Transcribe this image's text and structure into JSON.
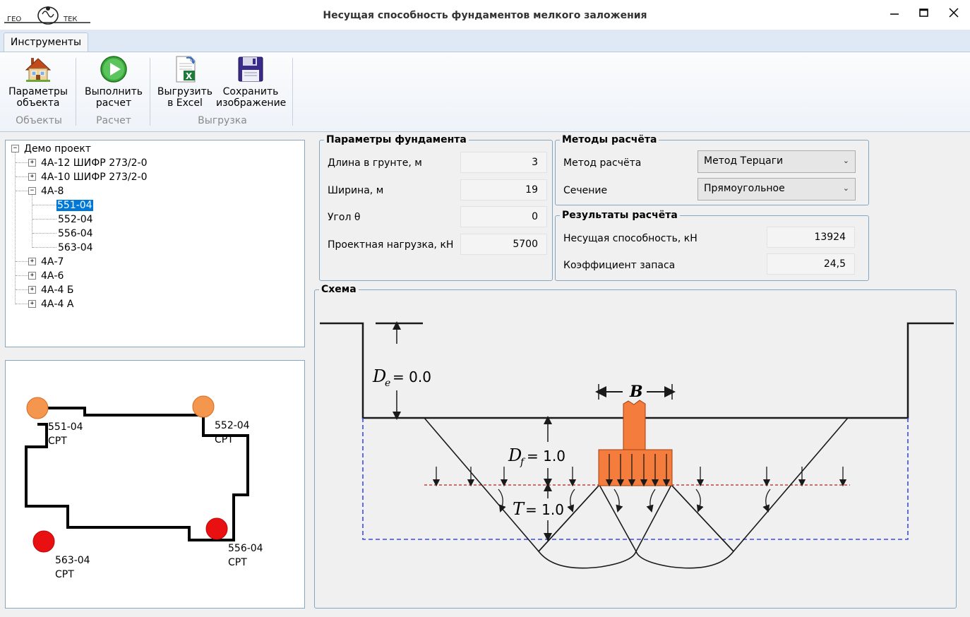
{
  "window": {
    "logo_text": "ГЕО ТЕК",
    "title": "Несущая способность фундаментов мелкого заложения",
    "minimize_glyph": "—",
    "maximize_glyph": "□",
    "close_glyph": "✕"
  },
  "ribbon": {
    "tab_label": "Инструменты",
    "buttons": [
      {
        "line1": "Параметры",
        "line2": "объекта",
        "icon": "house-icon"
      },
      {
        "line1": "Выполнить",
        "line2": "расчет",
        "icon": "play-icon"
      },
      {
        "line1": "Выгрузить",
        "line2": "в Excel",
        "icon": "excel-icon"
      },
      {
        "line1": "Сохранить",
        "line2": "изображение",
        "icon": "floppy-icon"
      }
    ],
    "groups": [
      "Объекты",
      "Расчет",
      "Выгрузка"
    ]
  },
  "tree": {
    "root": "Демо проект",
    "items": [
      "4А-12 ШИФР 273/2-0",
      "4А-10 ШИФР 273/2-0",
      "4А-8",
      "4А-7",
      "4А-6",
      "4А-4 Б",
      "4А-4 А"
    ],
    "children": [
      "551-04",
      "552-04",
      "556-04",
      "563-04"
    ],
    "plus": "+",
    "minus": "−"
  },
  "map": {
    "points": [
      {
        "id": "551-04",
        "type": "CPT",
        "color": "#f4964e"
      },
      {
        "id": "552-04",
        "type": "CPT",
        "color": "#f4964e"
      },
      {
        "id": "556-04",
        "type": "CPT",
        "color": "#e81010"
      },
      {
        "id": "563-04",
        "type": "CPT",
        "color": "#e81010"
      }
    ]
  },
  "foundation_params": {
    "title": "Параметры фундамента",
    "length_label": "Длина в грунте, м",
    "length_value": "3",
    "width_label": "Ширина, м",
    "width_value": "19",
    "angle_label": "Угол θ",
    "angle_value": "0",
    "load_label": "Проектная нагрузка, кН",
    "load_value": "5700"
  },
  "methods": {
    "title": "Методы расчёта",
    "method_label": "Метод расчёта",
    "method_value": "Метод Терцаги",
    "section_label": "Сечение",
    "section_value": "Прямоугольное",
    "chevron": "⌄"
  },
  "results": {
    "title": "Результаты расчёта",
    "capacity_label": "Несущая способность, кН",
    "capacity_value": "13924",
    "safety_label": "Коэффициент запаса",
    "safety_value": "24,5"
  },
  "scheme": {
    "title": "Схема",
    "de_sym": "D",
    "de_sub": "e",
    "de_val": "= 0.0",
    "df_sym": "D",
    "df_sub": "f",
    "df_val": "= 1.0",
    "t_sym": "T",
    "t_val": "= 1.0",
    "b_sym": "B",
    "footing_color": "#f47c3c",
    "line_color": "#1a1a1a",
    "dashed_blue": "#3b48e8",
    "dashed_red": "#b02020"
  }
}
